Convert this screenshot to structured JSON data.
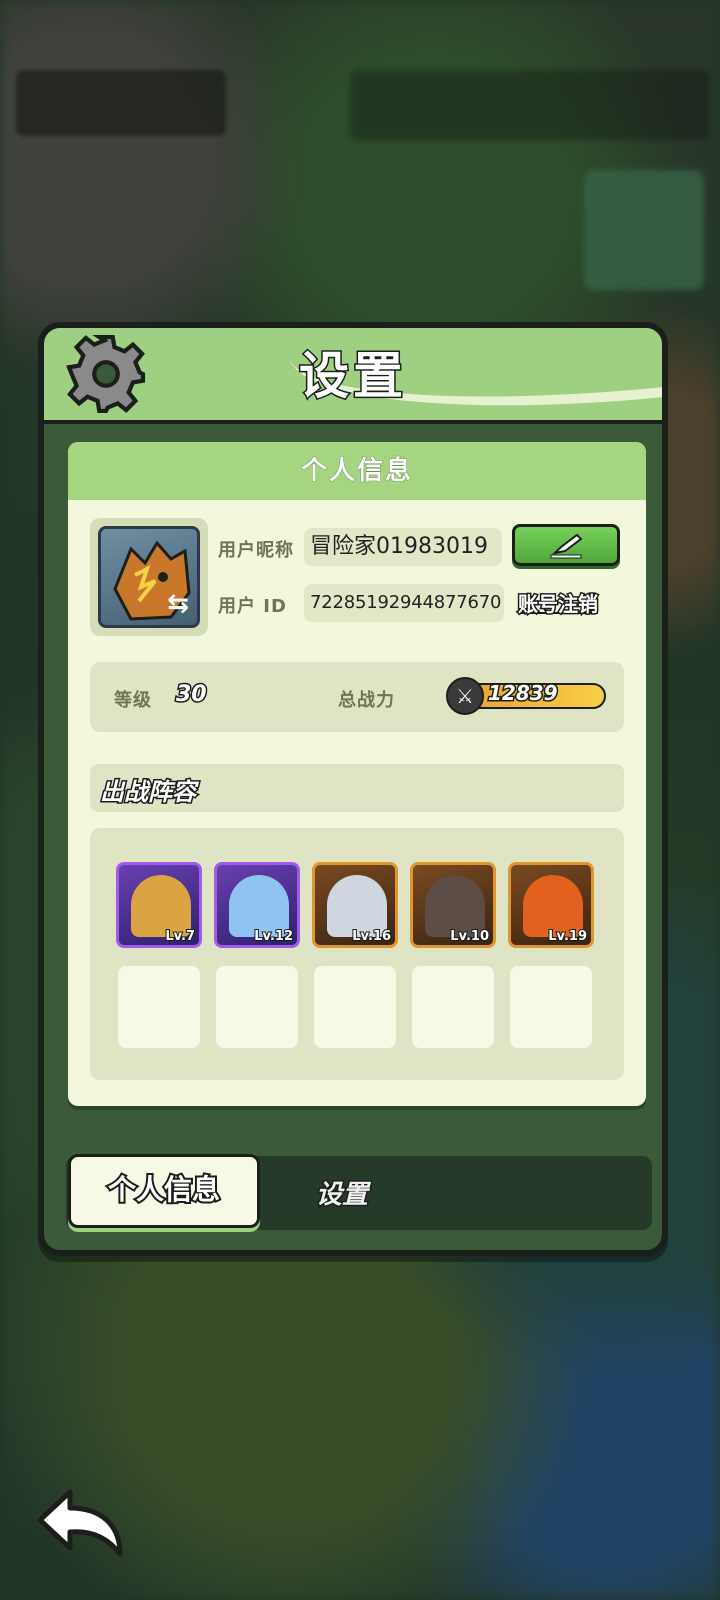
{
  "title": "设置",
  "card": {
    "header": "个人信息",
    "nickname_label": "用户昵称",
    "nickname": "冒险家01983019",
    "id_label": "用户 ID",
    "user_id": "72285192944877670",
    "logout_link": "账号注销",
    "level_label": "等级",
    "level": "30",
    "power_label": "总战力",
    "power": "12839",
    "lineup_title": "出战阵容",
    "heroes": [
      {
        "lv": "Lv.7",
        "rarity": "purple",
        "color": "#d9a441"
      },
      {
        "lv": "Lv.12",
        "rarity": "purple",
        "color": "#8fc3f2"
      },
      {
        "lv": "Lv.16",
        "rarity": "gold",
        "color": "#cfd6df"
      },
      {
        "lv": "Lv.10",
        "rarity": "gold",
        "color": "#5e4c46"
      },
      {
        "lv": "Lv.19",
        "rarity": "gold",
        "color": "#e2611f"
      }
    ]
  },
  "tabs": {
    "profile": "个人信息",
    "settings": "设置"
  },
  "icons": {
    "gear": "gear-icon",
    "edit": "pencil-icon",
    "swap": "swap-icon",
    "power": "crossed-swords-icon",
    "back": "back-arrow-icon"
  }
}
